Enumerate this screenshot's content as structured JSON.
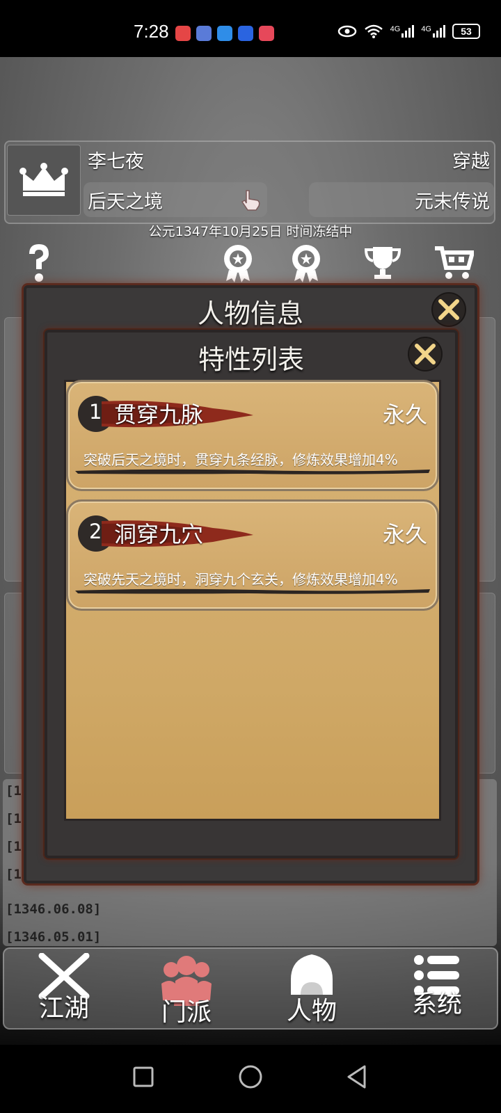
{
  "status_bar": {
    "time": "7:28",
    "network_1": "4G",
    "network_2": "4G",
    "battery": "53"
  },
  "player": {
    "name": "李七夜",
    "origin": "穿越",
    "realm": "后天之境",
    "title": "元末传说"
  },
  "date_line": "公元1347年10月25日 时间冻结中",
  "quick_icons": [
    {
      "icon": "help-icon"
    },
    {
      "icon": "medal-icon"
    },
    {
      "icon": "medal-icon"
    },
    {
      "icon": "trophy-icon"
    },
    {
      "icon": "cart-icon"
    }
  ],
  "log": {
    "lines": [
      "[13",
      "[13",
      "[13",
      "[134",
      "[1346.06.08]",
      "[1346.05.01]"
    ]
  },
  "outer_dialog": {
    "title": "人物信息"
  },
  "inner_dialog": {
    "title": "特性列表",
    "traits": [
      {
        "num": "1",
        "name": "贯穿九脉",
        "duration": "永久",
        "desc": "突破后天之境时，贯穿九条经脉，修炼效果增加4%"
      },
      {
        "num": "2",
        "name": "洞穿九穴",
        "duration": "永久",
        "desc": "突破先天之境时，洞穿九个玄关，修炼效果增加4%"
      }
    ]
  },
  "bottom_nav": {
    "items": [
      {
        "label": "江湖",
        "icon": "crossed-swords-icon"
      },
      {
        "label": "门派",
        "icon": "sect-icon"
      },
      {
        "label": "人物",
        "icon": "character-icon"
      },
      {
        "label": "系统",
        "icon": "menu-list-icon"
      }
    ]
  },
  "colors": {
    "parchment": "#d6b071",
    "dialog_bg": "#3b3939",
    "brush_red": "#8e2a1c",
    "sect_icon": "#e07a7a"
  }
}
